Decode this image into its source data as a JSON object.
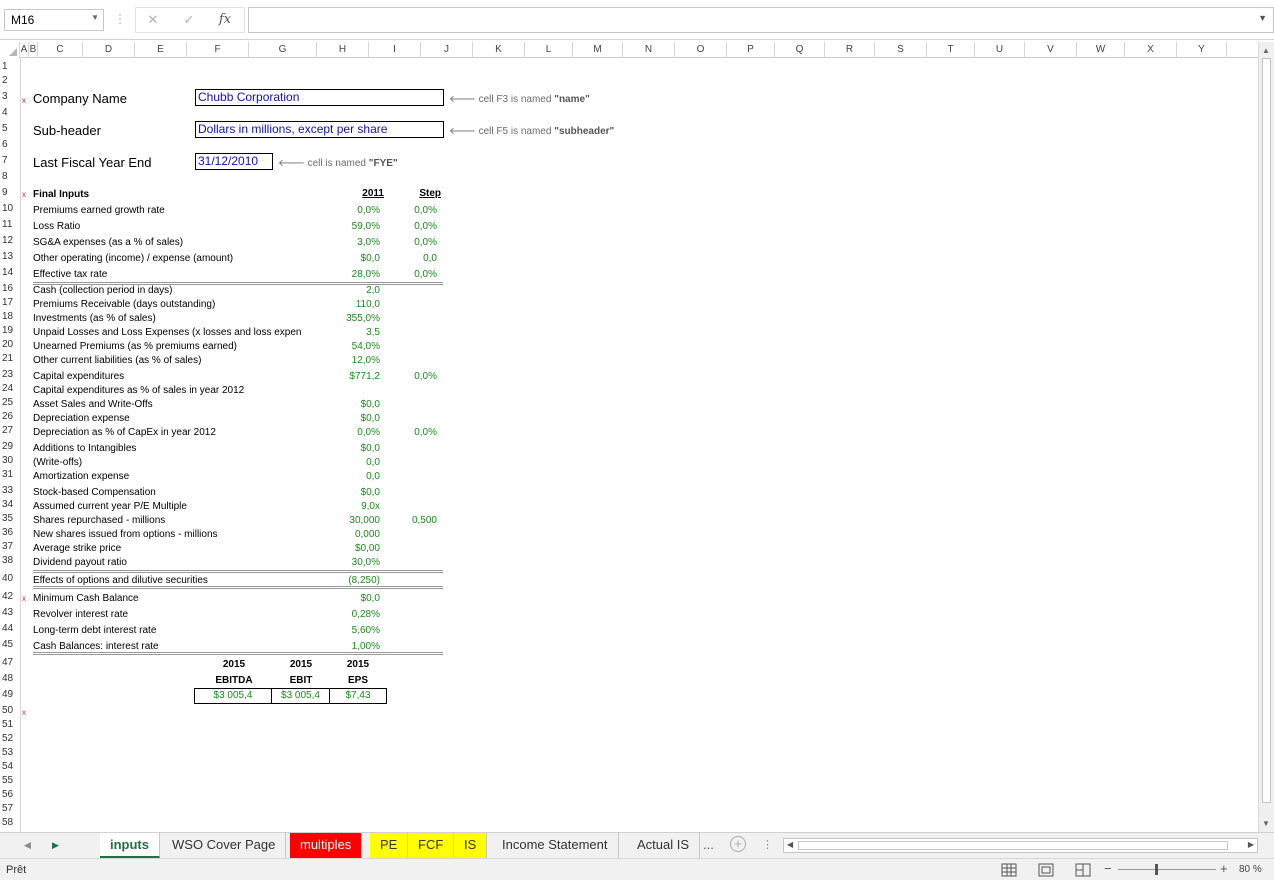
{
  "formula_bar": {
    "name_box": "M16",
    "cancel_icon": "✕",
    "enter_icon": "✓",
    "fx_label": "fx",
    "formula_value": ""
  },
  "columns": [
    "A",
    "B",
    "C",
    "D",
    "E",
    "F",
    "G",
    "H",
    "I",
    "J",
    "K",
    "L",
    "M",
    "N",
    "O",
    "P",
    "Q",
    "R",
    "S",
    "T",
    "U",
    "V",
    "W",
    "X",
    "Y"
  ],
  "rows": [
    "1",
    "2",
    "3",
    "4",
    "5",
    "6",
    "7",
    "8",
    "9",
    "10",
    "11",
    "12",
    "13",
    "14",
    "16",
    "17",
    "18",
    "19",
    "20",
    "21",
    "23",
    "24",
    "25",
    "26",
    "27",
    "29",
    "30",
    "31",
    "33",
    "34",
    "35",
    "36",
    "37",
    "38",
    "40",
    "42",
    "43",
    "44",
    "45",
    "47",
    "48",
    "49",
    "50",
    "51",
    "52",
    "53",
    "54",
    "55",
    "56",
    "57",
    "58"
  ],
  "header": {
    "company_label": "Company Name",
    "company_value": "Chubb Corporation",
    "company_note_prefix": "cell F3 is named ",
    "company_note_name": "\"name\"",
    "subheader_label": "Sub-header",
    "subheader_value": "Dollars in millions, except per share",
    "subheader_note_prefix": "cell F5 is named ",
    "subheader_note_name": "\"subheader\"",
    "fye_label": "Last Fiscal Year End",
    "fye_value": "31/12/2010",
    "fye_note_prefix": "cell is named ",
    "fye_note_name": "\"FYE\""
  },
  "inputs": {
    "title": "Final Inputs",
    "year_header": "2011",
    "step_header": "Step",
    "items": [
      {
        "label": "Premiums earned growth rate",
        "value": "0,0%",
        "step": "0,0%"
      },
      {
        "label": "Loss Ratio",
        "value": "59,0%",
        "step": "0,0%"
      },
      {
        "label": "SG&A expenses (as a % of sales)",
        "value": "3,0%",
        "step": "0,0%"
      },
      {
        "label": "Other operating (income) / expense (amount)",
        "value": "$0,0",
        "step": "0,0"
      },
      {
        "label": "Effective tax rate",
        "value": "28,0%",
        "step": "0,0%"
      },
      {
        "label": "Cash (collection period in days)",
        "value": "2,0",
        "step": ""
      },
      {
        "label": "Premiums Receivable (days outstanding)",
        "value": "110,0",
        "step": ""
      },
      {
        "label": "Investments (as % of sales)",
        "value": "355,0%",
        "step": ""
      },
      {
        "label": "Unpaid Losses and Loss Expenses (x losses and loss expen",
        "value": "3,5",
        "step": ""
      },
      {
        "label": "Unearned Premiums (as % premiums earned)",
        "value": "54,0%",
        "step": ""
      },
      {
        "label": "Other current liabilities (as % of sales)",
        "value": "12,0%",
        "step": ""
      },
      {
        "label": "Capital expenditures",
        "value": "$771,2",
        "step": "0,0%"
      },
      {
        "label": "Capital expenditures as % of sales in year 2012",
        "value": "",
        "step": ""
      },
      {
        "label": "Asset Sales and Write-Offs",
        "value": "$0,0",
        "step": ""
      },
      {
        "label": "Depreciation expense",
        "value": "$0,0",
        "step": ""
      },
      {
        "label": "Depreciation as % of CapEx in year 2012",
        "value": "0,0%",
        "step": "0,0%"
      },
      {
        "label": "Additions to Intangibles",
        "value": "$0,0",
        "step": ""
      },
      {
        "label": "(Write-offs)",
        "value": "0,0",
        "step": ""
      },
      {
        "label": "Amortization expense",
        "value": "0,0",
        "step": ""
      },
      {
        "label": "Stock-based Compensation",
        "value": "$0,0",
        "step": ""
      },
      {
        "label": "Assumed current year P/E Multiple",
        "value": "9,0x",
        "step": ""
      },
      {
        "label": "Shares repurchased - millions",
        "value": "30,000",
        "step": "0,500"
      },
      {
        "label": "New shares issued from options - millions",
        "value": "0,000",
        "step": ""
      },
      {
        "label": "Average strike price",
        "value": "$0,00",
        "step": ""
      },
      {
        "label": "Dividend payout ratio",
        "value": "30,0%",
        "step": ""
      },
      {
        "label": "Effects of options and dilutive securities",
        "value": "(8,250)",
        "step": ""
      },
      {
        "label": "Minimum Cash Balance",
        "value": "$0,0",
        "step": ""
      },
      {
        "label": "Revolver interest rate",
        "value": "0,28%",
        "step": ""
      },
      {
        "label": "Long-term debt  interest rate",
        "value": "5,60%",
        "step": ""
      },
      {
        "label": "Cash Balances: interest rate",
        "value": "1,00%",
        "step": ""
      }
    ]
  },
  "summary": {
    "years": [
      "2015",
      "2015",
      "2015"
    ],
    "metrics": [
      "EBITDA",
      "EBIT",
      "EPS"
    ],
    "values": [
      "$3 005,4",
      "$3 005,4",
      "$7,43"
    ]
  },
  "tabs": [
    {
      "label": "inputs",
      "color": "#ffffff",
      "active": true
    },
    {
      "label": "WSO Cover Page",
      "color": "#f1f1f1",
      "active": false
    },
    {
      "label": "multiples",
      "color": "#ff0000",
      "active": false
    },
    {
      "label": "PE",
      "color": "#ffff00",
      "active": false
    },
    {
      "label": "FCF",
      "color": "#ffff00",
      "active": false
    },
    {
      "label": "IS",
      "color": "#ffff00",
      "active": false
    },
    {
      "label": "Income Statement",
      "color": "#f1f1f1",
      "active": false
    },
    {
      "label": "Actual IS",
      "color": "#f1f1f1",
      "active": false
    }
  ],
  "tabs_more": "...",
  "status": {
    "ready": "Prêt",
    "zoom": "80 %"
  },
  "colors": {
    "input_blue": "#1010c0",
    "value_green": "#1a8c1a",
    "excel_green": "#217346"
  }
}
